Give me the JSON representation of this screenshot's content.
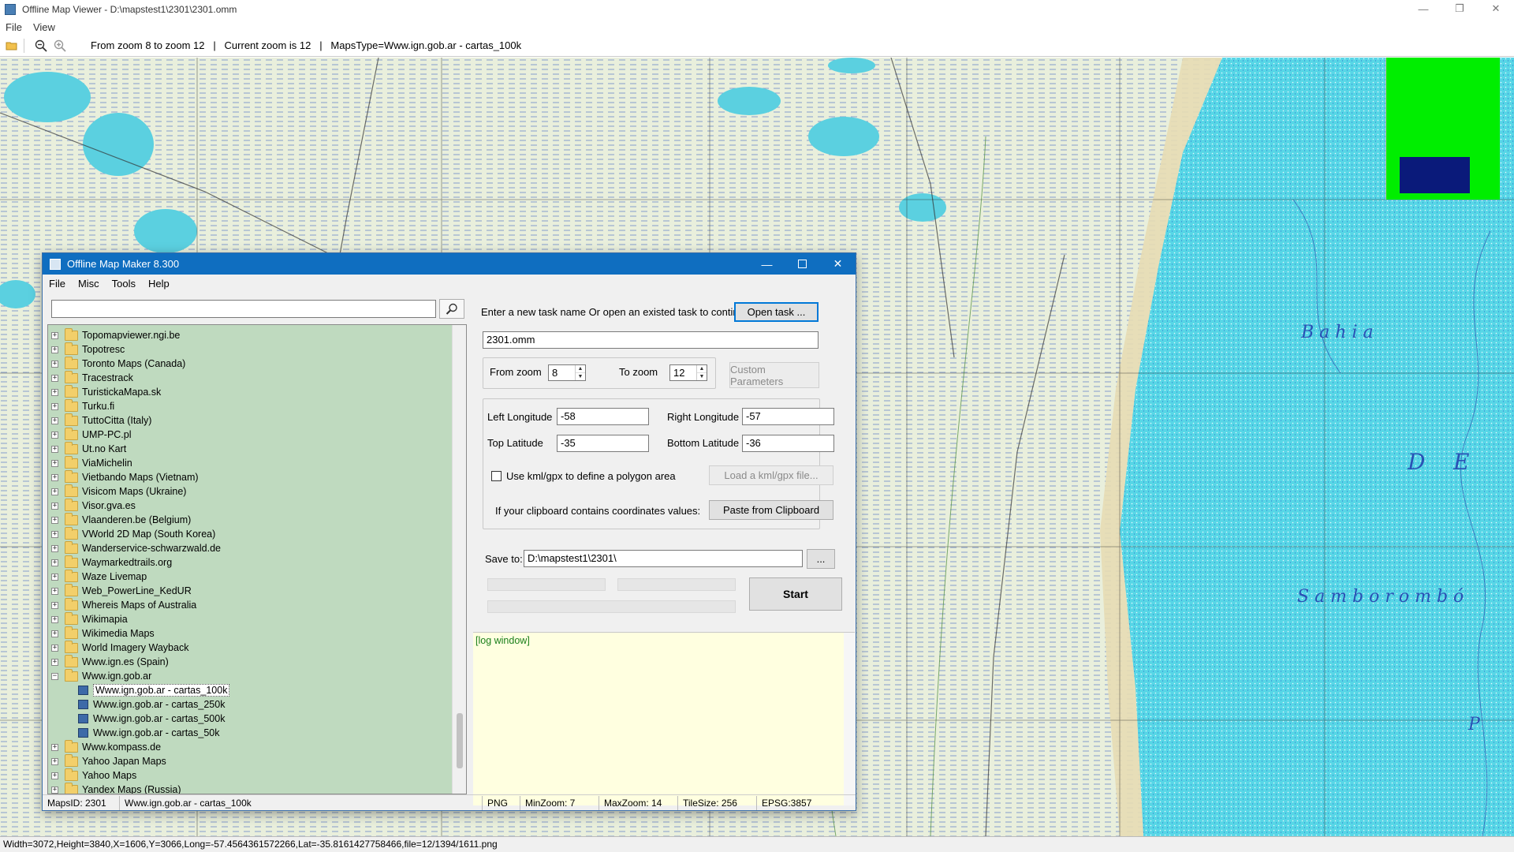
{
  "viewer": {
    "title": "Offline Map Viewer - D:\\mapstest1\\2301\\2301.omm",
    "menu": [
      "File",
      "View"
    ],
    "toolbar_info": "From zoom 8 to zoom 12   |   Current zoom is 12   |   MapsType=Www.ign.gob.ar - cartas_100k",
    "status": "Width=3072,Height=3840,X=1606,Y=3066,Long=-57.4564361572266,Lat=-35.8161427758466,file=12/1394/1611.png",
    "window_buttons": [
      "—",
      "❐",
      "✕"
    ]
  },
  "map_labels": {
    "bahia": "B a h i a",
    "de": "D    E",
    "samborombon": "S a m b o r o m b ó",
    "p": "P"
  },
  "dialog": {
    "title": "Offline Map Maker 8.300",
    "menu": [
      "File",
      "Misc",
      "Tools",
      "Help"
    ],
    "search_value": "",
    "tree": [
      {
        "label": "Topomapviewer.ngi.be",
        "type": "folder",
        "expander": "+"
      },
      {
        "label": "Topotresc",
        "type": "folder",
        "expander": "+"
      },
      {
        "label": "Toronto Maps (Canada)",
        "type": "folder",
        "expander": "+"
      },
      {
        "label": "Tracestrack",
        "type": "folder",
        "expander": "+"
      },
      {
        "label": "TuristickaMapa.sk",
        "type": "folder",
        "expander": "+"
      },
      {
        "label": "Turku.fi",
        "type": "folder",
        "expander": "+"
      },
      {
        "label": "TuttoCitta (Italy)",
        "type": "folder",
        "expander": "+"
      },
      {
        "label": "UMP-PC.pl",
        "type": "folder",
        "expander": "+"
      },
      {
        "label": "Ut.no Kart",
        "type": "folder",
        "expander": "+"
      },
      {
        "label": "ViaMichelin",
        "type": "folder",
        "expander": "+"
      },
      {
        "label": "Vietbando Maps (Vietnam)",
        "type": "folder",
        "expander": "+"
      },
      {
        "label": "Visicom Maps (Ukraine)",
        "type": "folder",
        "expander": "+"
      },
      {
        "label": "Visor.gva.es",
        "type": "folder",
        "expander": "+"
      },
      {
        "label": "Vlaanderen.be (Belgium)",
        "type": "folder",
        "expander": "+"
      },
      {
        "label": "VWorld 2D Map (South Korea)",
        "type": "folder",
        "expander": "+"
      },
      {
        "label": "Wanderservice-schwarzwald.de",
        "type": "folder",
        "expander": "+"
      },
      {
        "label": "Waymarkedtrails.org",
        "type": "folder",
        "expander": "+"
      },
      {
        "label": "Waze Livemap",
        "type": "folder",
        "expander": "+"
      },
      {
        "label": "Web_PowerLine_KedUR",
        "type": "folder",
        "expander": "+"
      },
      {
        "label": "Whereis Maps of Australia",
        "type": "folder",
        "expander": "+"
      },
      {
        "label": "Wikimapia",
        "type": "folder",
        "expander": "+"
      },
      {
        "label": "Wikimedia Maps",
        "type": "folder",
        "expander": "+"
      },
      {
        "label": "World Imagery Wayback",
        "type": "folder",
        "expander": "+"
      },
      {
        "label": "Www.ign.es (Spain)",
        "type": "folder",
        "expander": "+"
      },
      {
        "label": "Www.ign.gob.ar",
        "type": "folder-open",
        "expander": "−"
      },
      {
        "label": "Www.ign.gob.ar - cartas_100k",
        "type": "map",
        "selected": true
      },
      {
        "label": "Www.ign.gob.ar - cartas_250k",
        "type": "map"
      },
      {
        "label": "Www.ign.gob.ar - cartas_500k",
        "type": "map"
      },
      {
        "label": "Www.ign.gob.ar - cartas_50k",
        "type": "map"
      },
      {
        "label": "Www.kompass.de",
        "type": "folder",
        "expander": "+"
      },
      {
        "label": "Yahoo Japan Maps",
        "type": "folder",
        "expander": "+"
      },
      {
        "label": "Yahoo Maps",
        "type": "folder",
        "expander": "+"
      },
      {
        "label": "Yandex Maps (Russia)",
        "type": "folder",
        "expander": "+"
      }
    ],
    "task_prompt": "Enter a new task name Or open an existed task to continue:",
    "open_task_label": "Open task ...",
    "task_name": "2301.omm",
    "from_zoom_label": "From zoom",
    "from_zoom": "8",
    "to_zoom_label": "To zoom",
    "to_zoom": "12",
    "custom_params_label": "Custom Parameters",
    "left_lon_label": "Left Longitude",
    "left_lon": "-58",
    "right_lon_label": "Right Longitude",
    "right_lon": "-57",
    "top_lat_label": "Top Latitude",
    "top_lat": "-35",
    "bottom_lat_label": "Bottom Latitude",
    "bottom_lat": "-36",
    "kml_label": "Use kml/gpx to define a polygon area",
    "load_kml_label": "Load a kml/gpx file...",
    "clipboard_prompt": "If your clipboard contains coordinates values:",
    "paste_label": "Paste from Clipboard",
    "save_to_label": "Save to:",
    "save_to": "D:\\mapstest1\\2301\\",
    "browse_label": "...",
    "start_label": "Start",
    "log_text": "[log window]",
    "status": {
      "maps_id": "MapsID: 2301",
      "maps_name": "Www.ign.gob.ar - cartas_100k",
      "format": "PNG",
      "min_zoom": "MinZoom: 7",
      "max_zoom": "MaxZoom: 14",
      "tile_size": "TileSize: 256",
      "epsg": "EPSG:3857"
    }
  },
  "colors": {
    "map_land": "#e8eed9",
    "map_sea": "#57d6e6",
    "dialog_title": "#0f6ec0",
    "tree_bg": "#bfdabf",
    "log_bg": "#ffffe0",
    "navigator": "#00ee00",
    "navigator_rect": "#0a1a7a"
  }
}
